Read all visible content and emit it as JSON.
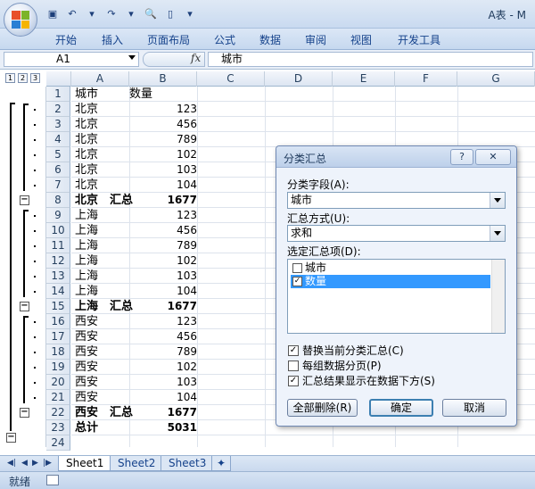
{
  "window": {
    "title": "A表 - M"
  },
  "ribbon": {
    "tabs": [
      "开始",
      "插入",
      "页面布局",
      "公式",
      "数据",
      "审阅",
      "视图",
      "开发工具"
    ]
  },
  "formula_bar": {
    "name_box": "A1",
    "fx": "fx",
    "value": "城市"
  },
  "outline_levels": [
    "1",
    "2",
    "3"
  ],
  "columns": [
    "A",
    "B",
    "C",
    "D",
    "E",
    "F",
    "G"
  ],
  "rows": [
    {
      "n": "1",
      "a": "城市",
      "b": "数量",
      "bold": false,
      "hdr": true
    },
    {
      "n": "2",
      "a": "北京",
      "b": "123",
      "bold": false
    },
    {
      "n": "3",
      "a": "北京",
      "b": "456",
      "bold": false
    },
    {
      "n": "4",
      "a": "北京",
      "b": "789",
      "bold": false
    },
    {
      "n": "5",
      "a": "北京",
      "b": "102",
      "bold": false
    },
    {
      "n": "6",
      "a": "北京",
      "b": "103",
      "bold": false
    },
    {
      "n": "7",
      "a": "北京",
      "b": "104",
      "bold": false
    },
    {
      "n": "8",
      "a": "北京　汇总",
      "b": "1677",
      "bold": true
    },
    {
      "n": "9",
      "a": "上海",
      "b": "123",
      "bold": false
    },
    {
      "n": "10",
      "a": "上海",
      "b": "456",
      "bold": false
    },
    {
      "n": "11",
      "a": "上海",
      "b": "789",
      "bold": false
    },
    {
      "n": "12",
      "a": "上海",
      "b": "102",
      "bold": false
    },
    {
      "n": "13",
      "a": "上海",
      "b": "103",
      "bold": false
    },
    {
      "n": "14",
      "a": "上海",
      "b": "104",
      "bold": false
    },
    {
      "n": "15",
      "a": "上海　汇总",
      "b": "1677",
      "bold": true
    },
    {
      "n": "16",
      "a": "西安",
      "b": "123",
      "bold": false
    },
    {
      "n": "17",
      "a": "西安",
      "b": "456",
      "bold": false
    },
    {
      "n": "18",
      "a": "西安",
      "b": "789",
      "bold": false
    },
    {
      "n": "19",
      "a": "西安",
      "b": "102",
      "bold": false
    },
    {
      "n": "20",
      "a": "西安",
      "b": "103",
      "bold": false
    },
    {
      "n": "21",
      "a": "西安",
      "b": "104",
      "bold": false
    },
    {
      "n": "22",
      "a": "西安　汇总",
      "b": "1677",
      "bold": true
    },
    {
      "n": "23",
      "a": "总计",
      "b": "5031",
      "bold": true
    },
    {
      "n": "24",
      "a": "",
      "b": "",
      "bold": false
    }
  ],
  "sheets": [
    "Sheet1",
    "Sheet2",
    "Sheet3"
  ],
  "status": {
    "ready": "就绪"
  },
  "dialog": {
    "title": "分类汇总",
    "help": "?",
    "close": "✕",
    "field_label": "分类字段(A):",
    "field_value": "城市",
    "method_label": "汇总方式(U):",
    "method_value": "求和",
    "items_label": "选定汇总项(D):",
    "items": [
      {
        "label": "城市",
        "checked": false,
        "selected": false
      },
      {
        "label": "数量",
        "checked": true,
        "selected": true
      }
    ],
    "options": [
      {
        "label": "替换当前分类汇总(C)",
        "checked": true
      },
      {
        "label": "每组数据分页(P)",
        "checked": false
      },
      {
        "label": "汇总结果显示在数据下方(S)",
        "checked": true
      }
    ],
    "btn_remove_all": "全部删除(R)",
    "btn_ok": "确定",
    "btn_cancel": "取消"
  },
  "colors": {
    "ribbon_text": "#15428b",
    "selection": "#3399ff"
  }
}
